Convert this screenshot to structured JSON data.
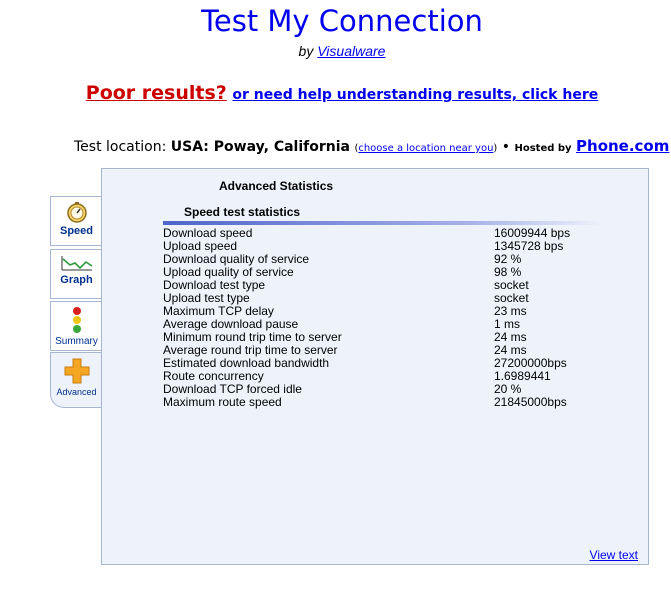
{
  "header": {
    "title": "Test My Connection",
    "by_prefix": "by",
    "by_link": "Visualware",
    "poor_link": "Poor results?",
    "help_link": "or need help understanding results, click here"
  },
  "location": {
    "prefix": "Test location:",
    "name": "USA: Poway, California",
    "choose_open": "(",
    "choose_link": "choose a location near you",
    "choose_close": ")",
    "bullet": "•",
    "hosted_by": "Hosted by",
    "host_link": "Phone.com"
  },
  "tabs": [
    {
      "label": "Speed",
      "icon": "stopwatch-icon"
    },
    {
      "label": "Graph",
      "icon": "line-graph-icon"
    },
    {
      "label": "Summary",
      "icon": "traffic-light-icon"
    },
    {
      "label": "Advanced",
      "icon": "plus-icon"
    }
  ],
  "panel": {
    "heading": "Advanced Statistics",
    "section": "Speed test statistics",
    "view_text": "View text",
    "stats": [
      {
        "label": "Download speed",
        "value": "16009944 bps"
      },
      {
        "label": "Upload speed",
        "value": "1345728 bps"
      },
      {
        "label": "Download quality of service",
        "value": "92 %"
      },
      {
        "label": "Upload quality of service",
        "value": "98 %"
      },
      {
        "label": "Download test type",
        "value": "socket"
      },
      {
        "label": "Upload test type",
        "value": "socket"
      },
      {
        "label": "Maximum TCP delay",
        "value": "23 ms"
      },
      {
        "label": "Average download pause",
        "value": "1 ms"
      },
      {
        "label": "Minimum round trip time to server",
        "value": "24 ms"
      },
      {
        "label": "Average round trip time to server",
        "value": "24 ms"
      },
      {
        "label": "Estimated download bandwidth",
        "value": "27200000bps"
      },
      {
        "label": "Route concurrency",
        "value": "1.6989441"
      },
      {
        "label": "Download TCP forced idle",
        "value": "20 %"
      },
      {
        "label": "Maximum route speed",
        "value": "21845000bps"
      }
    ]
  },
  "colors": {
    "link": "#0000ee",
    "poor": "#cc0000",
    "panel_bg": "#eef3fb",
    "accent_bar": "#4d63c9"
  }
}
